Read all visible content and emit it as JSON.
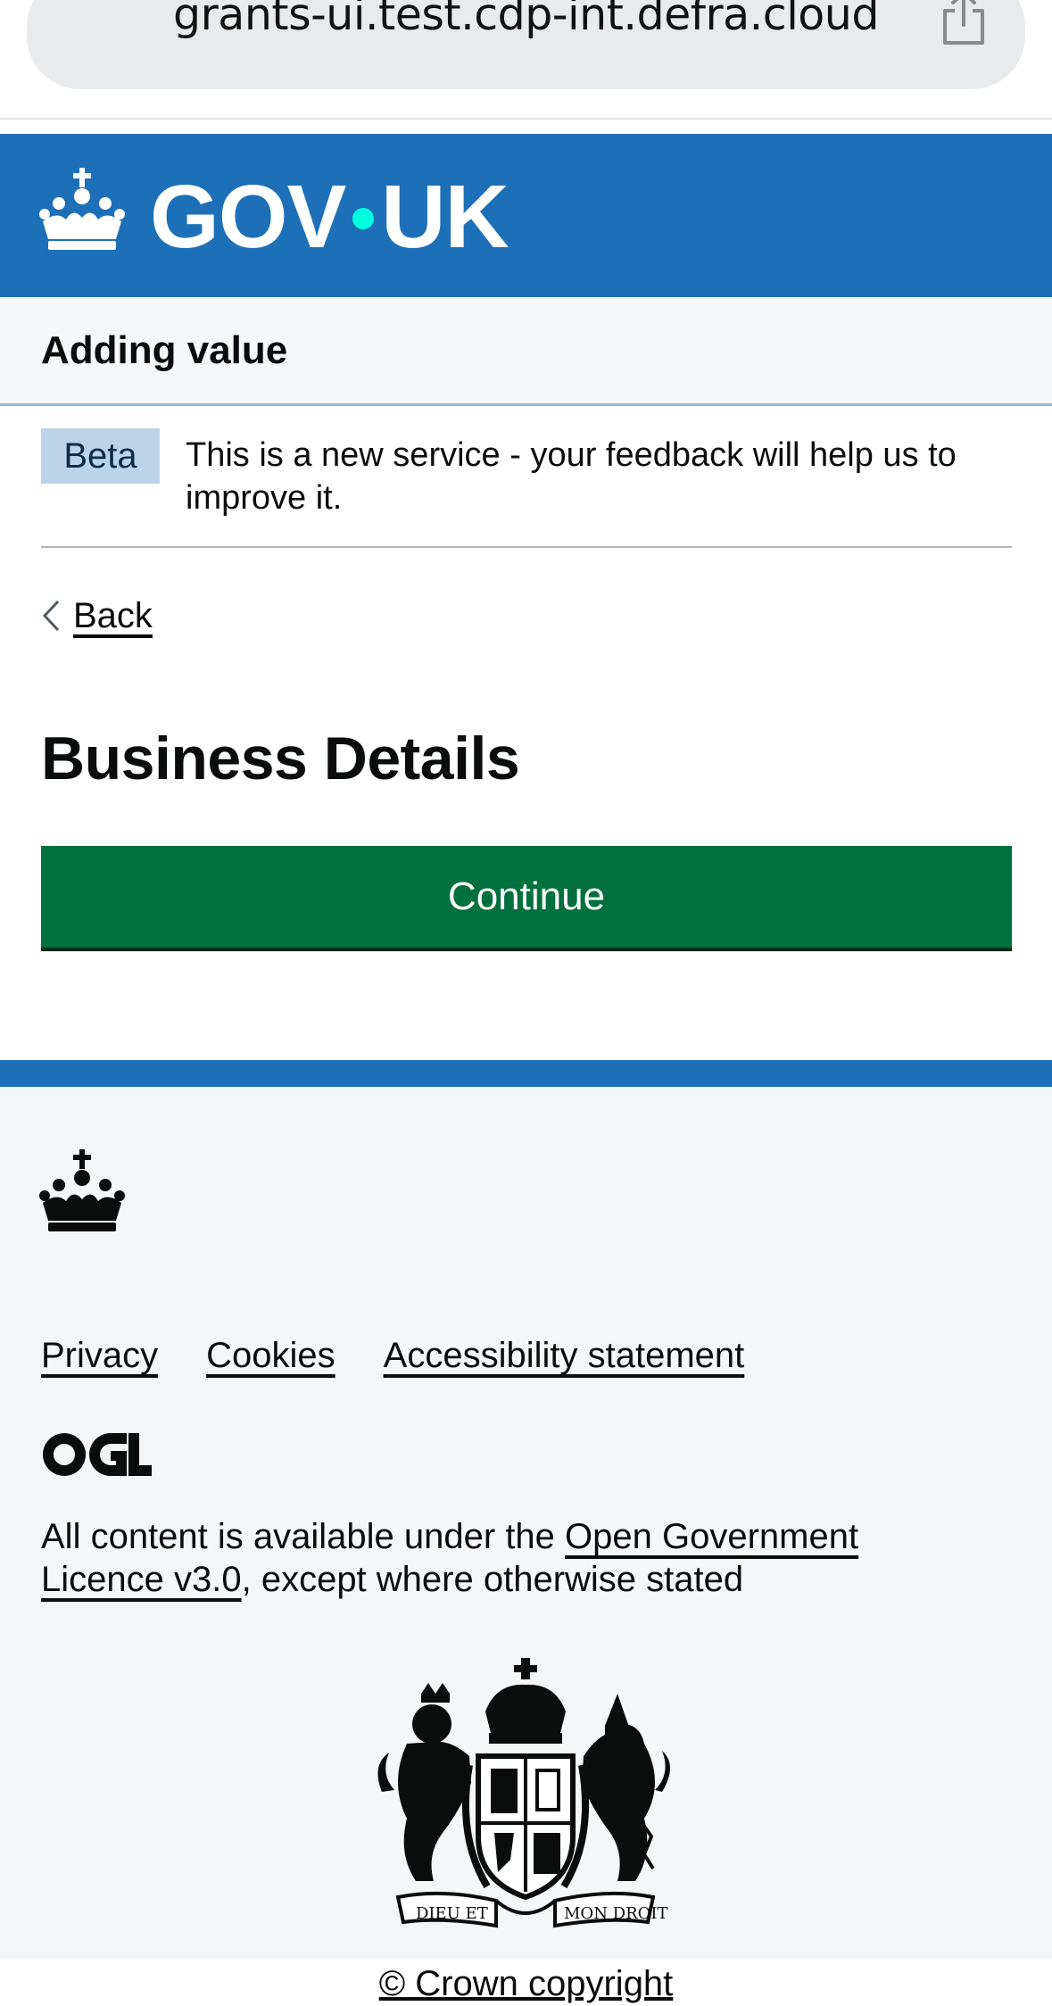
{
  "browser": {
    "url": "grants-ui.test.cdp-int.defra.cloud",
    "share_icon": "share-icon"
  },
  "header": {
    "logotype_left": "GOV",
    "logotype_right": "UK",
    "logo_icon": "crown-icon",
    "brand_color": "#1d70b8",
    "dot_color": "#00ffe0"
  },
  "service": {
    "name": "Adding value"
  },
  "phase_banner": {
    "tag": "Beta",
    "text": "This is a new service - your feedback will help us to improve it."
  },
  "back_link": {
    "label": "Back",
    "icon": "chevron-left-icon"
  },
  "main": {
    "title": "Business Details",
    "continue_label": "Continue",
    "button_color": "#00703c"
  },
  "footer": {
    "links": [
      "Privacy",
      "Cookies",
      "Accessibility statement"
    ],
    "ogl_icon": "ogl-logo-icon",
    "licence_prefix": "All content is available under the ",
    "licence_link": "Open Government Licence v3.0",
    "licence_suffix": ", except where otherwise stated",
    "crest_icon": "royal-coat-of-arms-icon",
    "copyright": "© Crown copyright"
  }
}
